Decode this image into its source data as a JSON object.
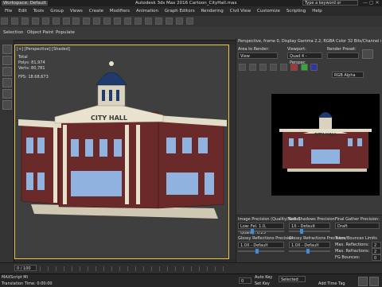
{
  "app": {
    "title": "Autodesk 3ds Max 2016    Cartoon_CityHall.max",
    "workspace": "Workspace: Default",
    "search_placeholder": "Type a keyword or phrase"
  },
  "menu": [
    "File",
    "Edit",
    "Tools",
    "Group",
    "Views",
    "Create",
    "Modifiers",
    "Animation",
    "Graph Editors",
    "Rendering",
    "Civil View",
    "Customize",
    "Scripting",
    "Help"
  ],
  "ribbon": {
    "left": "Selection",
    "mid": "Object Paint",
    "right": "Populate"
  },
  "viewport": {
    "label": "[+] [Perspective] [Shaded]",
    "stats": {
      "total": "Total",
      "polys_label": "Polys:",
      "polys": "81,974",
      "verts_label": "Verts:",
      "verts": "80,781",
      "fps_label": "FPS:",
      "fps": "18.68,673"
    },
    "sign": "CITY HALL"
  },
  "vfb": {
    "title": "Perspective, frame 0, Display Gamma 2.2, RGBA Color 32 Bits/Channel (1:4)",
    "area_label": "Area to Render:",
    "area_value": "View",
    "viewport_label": "Viewport:",
    "viewport_value": "Quad 4 - Perspec",
    "preset_label": "Render Preset:",
    "channel_value": "RGB Alpha",
    "render_sign": "CITY HALL",
    "panels": [
      {
        "title": "Image Precision (Quality/Noise):",
        "value": "Low: Fel. 1.0, Quality: 0.23"
      },
      {
        "title": "Soft Shadows Precision:",
        "value": "1X - Default"
      },
      {
        "title": "Final Gather Precision:",
        "value": "Draft"
      }
    ],
    "panels2": [
      {
        "title": "Glossy Reflections Precision:",
        "value": "1.0X - Default"
      },
      {
        "title": "Glossy Refractions Precision:",
        "value": "1.0X - Default"
      },
      {
        "title": "Trace/Bounces Limits",
        "value": ""
      }
    ],
    "limits": [
      {
        "label": "Max. Reflections:",
        "value": "2"
      },
      {
        "label": "Max. Refractions:",
        "value": "2"
      },
      {
        "label": "FG Bounces:",
        "value": "0"
      }
    ]
  },
  "timeline": {
    "frame": "0 / 100",
    "ticks": [
      "0",
      "10",
      "20",
      "30",
      "40",
      "50",
      "60",
      "70",
      "80",
      "90",
      "100"
    ]
  },
  "status": {
    "text": "Translation Time: 0:00:00",
    "maxscript": "MAXScript Mi",
    "frame_field": "0",
    "autokey": "Auto Key",
    "setkey": "Set Key",
    "selected": "Selected",
    "addtime": "Add Time Tag"
  },
  "colors": {
    "accent": "#e6c84a",
    "brick": "#6b2a2a",
    "stone": "#d8d2bf",
    "glass": "#8fb2de",
    "dome": "#1f3a6b"
  }
}
